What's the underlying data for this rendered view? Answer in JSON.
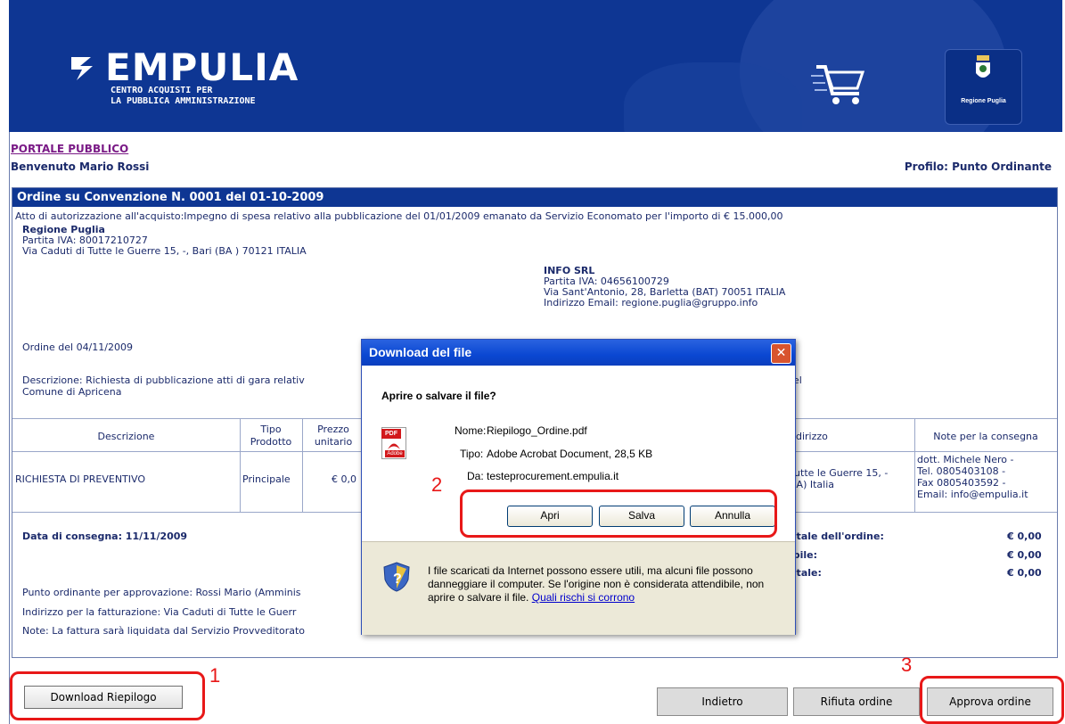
{
  "header": {
    "brand": "EMPULIA",
    "subtitle_line1": "CENTRO ACQUISTI PER",
    "subtitle_line2": "LA PUBBLICA AMMINISTRAZIONE",
    "region_badge": "Regione Puglia"
  },
  "nav": {
    "portal_link": "PORTALE PUBBLICO",
    "welcome": "Benvenuto Mario Rossi",
    "profile": "Profilo: Punto Ordinante"
  },
  "order": {
    "title": "Ordine su Convenzione N. 0001 del 01-10-2009",
    "authorization": "Atto di autorizzazione all'acquisto:Impegno di spesa relativo alla pubblicazione del 01/01/2009 emanato da Servizio Economato per l'importo di € 15.000,00",
    "buyer": {
      "name": "Regione Puglia",
      "vat": "Partita IVA: 80017210727",
      "address": "Via Caduti di Tutte le Guerre 15, -, Bari (BA ) 70121 ITALIA"
    },
    "supplier": {
      "name": "INFO SRL",
      "vat": "Partita IVA: 04656100729",
      "address": "Via Sant'Antonio, 28, Barletta (BAT) 70051 ITALIA",
      "email": "Indirizzo Email: regione.puglia@gruppo.info"
    },
    "order_date": "Ordine del 04/11/2009",
    "description_line1": "Descrizione: Richiesta di pubblicazione atti di gara relativ",
    "description_tail": "el",
    "description_line2": "Comune di Apricena",
    "table": {
      "headers": [
        "Descrizione",
        "Tipo Prodotto",
        "Prezzo unitario",
        "ndirizzo",
        "Note per la consegna"
      ],
      "tipo_line1": "Tipo",
      "tipo_line2": "Prodotto",
      "prezzo_line1": "Prezzo",
      "prezzo_line2": "unitario",
      "row": {
        "descrizione": "RICHIESTA DI PREVENTIVO",
        "tipo": "Principale",
        "prezzo": "€ 0,0",
        "indirizzo_line1": "Tutte le Guerre 15, -",
        "indirizzo_line2": "BA) Italia",
        "note_line1": "dott. Michele Nero -",
        "note_line2": "Tel. 0805403108 -",
        "note_line3": "Fax 0805403592 -",
        "note_line4": "Email: info@empulia.it"
      }
    },
    "delivery_date": "Data di consegna: 11/11/2009",
    "totals": [
      {
        "label": "otale dell'ordine:",
        "value": "€ 0,00"
      },
      {
        "label": "ibile:",
        "value": "€ 0,00"
      },
      {
        "label": "otale:",
        "value": "€ 0,00"
      }
    ],
    "approval_point": "Punto ordinante per approvazione: Rossi Mario (Amminis",
    "billing_address": "Indirizzo per la fatturazione: Via Caduti di Tutte le Guerr",
    "notes": "Note: La fattura sarà liquidata dal Servizio Provveditorato"
  },
  "dialog": {
    "title": "Download del file",
    "question": "Aprire o salvare il file?",
    "name_label": "Nome:",
    "name_value": "Riepilogo_Ordine.pdf",
    "type_label": "Tipo:",
    "type_value": "Adobe Acrobat Document, 28,5 KB",
    "from_label": "Da:",
    "from_value": "testeprocurement.empulia.it",
    "open_label": "Apri",
    "save_label": "Salva",
    "cancel_label": "Annulla",
    "warning": "I file scaricati da Internet possono essere utili, ma alcuni file possono danneggiare il computer. Se l'origine non è considerata attendibile, non aprire o salvare il file.",
    "risk_link": "Quali rischi si corrono",
    "pdf_badge": "PDF",
    "adobe_badge": "Adobe"
  },
  "annotations": {
    "one": "1",
    "two": "2",
    "three": "3"
  },
  "footer": {
    "download_label": "Download Riepilogo",
    "back_label": "Indietro",
    "reject_label": "Rifiuta ordine",
    "approve_label": "Approva ordine"
  }
}
